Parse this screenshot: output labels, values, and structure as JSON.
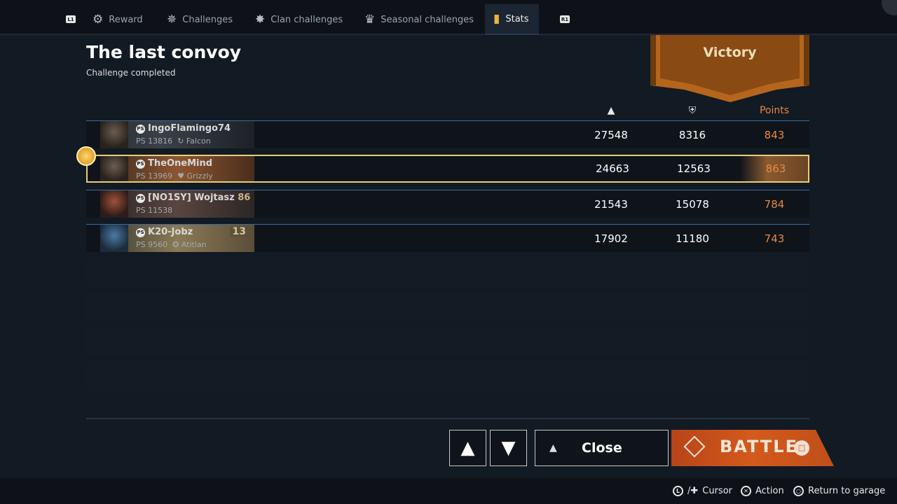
{
  "tabs": [
    {
      "label": "Reward",
      "icon": "reward-icon"
    },
    {
      "label": "Challenges",
      "icon": "challenges-icon"
    },
    {
      "label": "Clan challenges",
      "icon": "clan-challenges-icon"
    },
    {
      "label": "Seasonal challenges",
      "icon": "seasonal-challenges-icon"
    },
    {
      "label": "Stats",
      "icon": "stats-icon",
      "active": true
    }
  ],
  "shoulders": {
    "left": "L1",
    "right": "R1"
  },
  "header": {
    "title": "The last convoy",
    "subtitle": "Challenge completed",
    "result": "Victory"
  },
  "columns": {
    "damage_icon": "damage-icon",
    "armor_icon": "armor-icon",
    "points": "Points"
  },
  "players": [
    {
      "name": "IngoFlamingo74",
      "rating": "PS 13816",
      "clan_icon": "falcon-clan-icon",
      "clan": "Falcon",
      "damage": "27548",
      "armor": "8316",
      "points": "843"
    },
    {
      "name": "TheOneMind",
      "rating": "PS 13969",
      "clan_icon": "grizzly-clan-icon",
      "clan": "Grizzly",
      "damage": "24663",
      "armor": "12563",
      "points": "863",
      "selected": true
    },
    {
      "name": "[NO1SY] Wojtasz",
      "level": "86",
      "rating": "PS 11538",
      "damage": "21543",
      "armor": "15078",
      "points": "784"
    },
    {
      "name": "K20-Jobz",
      "level": "13",
      "rating": "PS 9560",
      "clan_icon": "atitlan-clan-icon",
      "clan": "Atitlan",
      "damage": "17902",
      "armor": "11180",
      "points": "743"
    }
  ],
  "buttons": {
    "like": "thumbs-up-icon",
    "dislike": "thumbs-down-icon",
    "close": "Close",
    "battle": "BATTLE"
  },
  "footer": {
    "cursor": "Cursor",
    "action": "Action",
    "return": "Return to garage"
  },
  "colors": {
    "accent": "#e8883e",
    "selected_border": "#e6cf7a",
    "battle": "#d45a1c"
  }
}
